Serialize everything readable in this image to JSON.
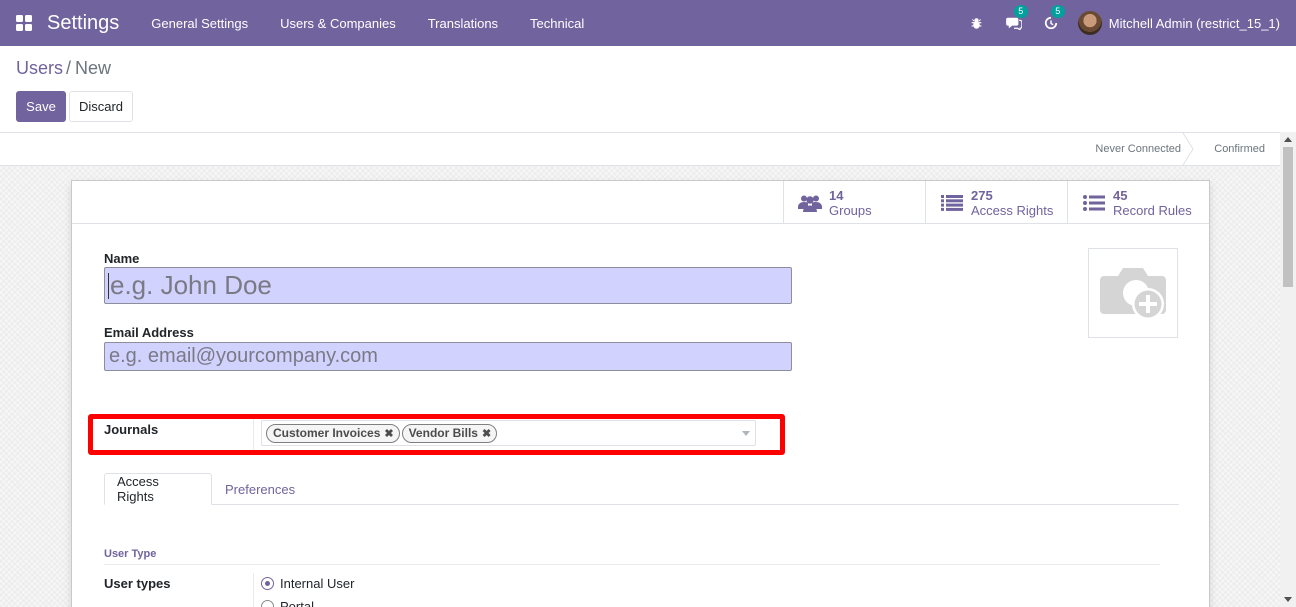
{
  "navbar": {
    "app_title": "Settings",
    "menu": [
      "General Settings",
      "Users & Companies",
      "Translations",
      "Technical"
    ],
    "messages_badge": "5",
    "activities_badge": "5",
    "user_name": "Mitchell Admin (restrict_15_1)",
    "icons": [
      "apps-grid-icon",
      "bug-icon",
      "chat-icon",
      "clock-icon"
    ]
  },
  "breadcrumb": {
    "parent": "Users",
    "separator": "/",
    "current": "New"
  },
  "actions": {
    "save": "Save",
    "discard": "Discard"
  },
  "statusbar": {
    "stages": [
      "Never Connected",
      "Confirmed"
    ]
  },
  "smart_buttons": [
    {
      "value": "14",
      "label": "Groups",
      "icon": "users-icon"
    },
    {
      "value": "275",
      "label": "Access Rights",
      "icon": "list-icon"
    },
    {
      "value": "45",
      "label": "Record Rules",
      "icon": "list-icon"
    }
  ],
  "form": {
    "name_label": "Name",
    "name_placeholder": "e.g. John Doe",
    "email_label": "Email Address",
    "email_placeholder": "e.g. email@yourcompany.com",
    "journals_label": "Journals",
    "journals_tags": [
      "Customer Invoices",
      "Vendor Bills"
    ],
    "image_icon": "camera-add-icon"
  },
  "tabs": [
    "Access Rights",
    "Preferences"
  ],
  "access_rights": {
    "group_title": "User Type",
    "user_types_label": "User types",
    "options": [
      "Internal User",
      "Portal"
    ],
    "selected": "Internal User"
  },
  "colors": {
    "brand": "#71639e",
    "input_required_bg": "#d2d2ff",
    "highlight": "#ff0000",
    "badge": "#00a09d"
  }
}
